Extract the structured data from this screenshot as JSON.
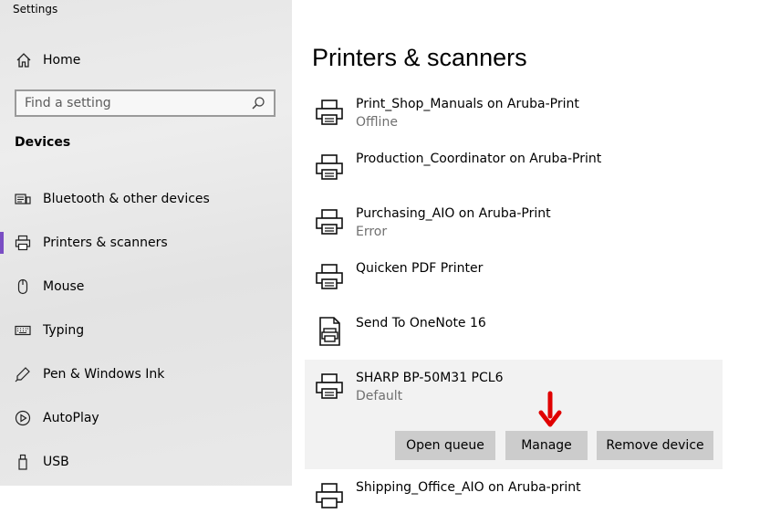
{
  "window": {
    "title": "Settings"
  },
  "sidebar": {
    "home_label": "Home",
    "search_placeholder": "Find a setting",
    "section_title": "Devices",
    "items": [
      {
        "label": "Bluetooth & other devices",
        "icon": "bluetooth-devices-icon"
      },
      {
        "label": "Printers & scanners",
        "icon": "printer-icon",
        "active": true
      },
      {
        "label": "Mouse",
        "icon": "mouse-icon"
      },
      {
        "label": "Typing",
        "icon": "keyboard-icon"
      },
      {
        "label": "Pen & Windows Ink",
        "icon": "pen-icon"
      },
      {
        "label": "AutoPlay",
        "icon": "autoplay-icon"
      },
      {
        "label": "USB",
        "icon": "usb-icon"
      }
    ]
  },
  "main": {
    "title": "Printers & scanners",
    "printers": [
      {
        "name": "Print_Shop_Manuals on Aruba-Print",
        "status": "Offline"
      },
      {
        "name": "Production_Coordinator on Aruba-Print",
        "status": ""
      },
      {
        "name": "Purchasing_AIO on Aruba-Print",
        "status": "Error"
      },
      {
        "name": "Quicken PDF Printer",
        "status": ""
      },
      {
        "name": "Send To OneNote 16",
        "status": ""
      },
      {
        "name": "SHARP BP-50M31 PCL6",
        "status": "Default",
        "selected": true
      },
      {
        "name": "Shipping_Office_AIO on Aruba-print",
        "status": ""
      }
    ],
    "actions": {
      "open_queue": "Open queue",
      "manage": "Manage",
      "remove_device": "Remove device"
    }
  },
  "colors": {
    "accent": "#7a4ec4",
    "annotation_arrow": "#e00000",
    "button_bg": "#cccccc",
    "selected_bg": "#f2f2f2"
  }
}
